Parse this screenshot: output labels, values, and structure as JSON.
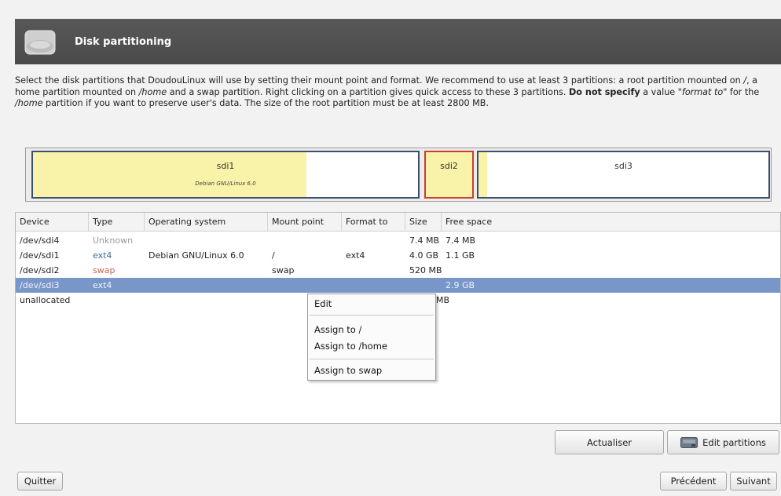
{
  "header": {
    "title": "Disk partitioning",
    "icon": "hard-disk-icon"
  },
  "intro": {
    "p1": "Select the disk partitions that DoudouLinux will use by setting their mount point and format. We recommend to use at least 3 partitions: a root partition mounted on ",
    "root": "/",
    "p2": ", a home partition mounted on ",
    "home": "/home",
    "p3": " and a swap partition. Right clicking on a partition gives quick access to these 3 partitions. ",
    "bold": "Do not specify",
    "p4": " a value ",
    "format_to": "\"format to\"",
    "p5": " for the ",
    "home2": "/home",
    "p6": " partition if you want to preserve user's data. The size of the root partition must be at least 2800 MB."
  },
  "partition_bar": {
    "segments": [
      {
        "name": "sdi1",
        "os": "Debian GNU/Linux 6.0",
        "used_fraction": 0.71
      },
      {
        "name": "sdi2",
        "os": "",
        "used_fraction": 1.0
      },
      {
        "name": "sdi3",
        "os": "",
        "used_fraction": 0.03
      }
    ]
  },
  "table": {
    "columns": [
      "Device",
      "Type",
      "Operating system",
      "Mount point",
      "Format to",
      "Size",
      "Free space"
    ],
    "rows": [
      {
        "device": "/dev/sdi4",
        "type": "Unknown",
        "os": "",
        "mount": "",
        "format": "",
        "size": "7.4 MB",
        "free": "7.4 MB"
      },
      {
        "device": "/dev/sdi1",
        "type": "ext4",
        "os": "Debian GNU/Linux 6.0",
        "mount": "/",
        "format": "ext4",
        "size": "4.0 GB",
        "free": "1.1 GB"
      },
      {
        "device": "/dev/sdi2",
        "type": "swap",
        "os": "",
        "mount": "swap",
        "format": "",
        "size": "520 MB",
        "free": ""
      },
      {
        "device": "/dev/sdi3",
        "type": "ext4",
        "os": "",
        "mount": "",
        "format": "",
        "size": "",
        "free": "2.9 GB"
      },
      {
        "device": "unallocated",
        "type": "",
        "os": "",
        "mount": "",
        "format": "",
        "size": "MB",
        "free": ""
      }
    ]
  },
  "context_menu": {
    "items": [
      "Edit",
      "Assign to /",
      "Assign to /home",
      "Assign to swap"
    ]
  },
  "buttons": {
    "refresh": "Actualiser",
    "edit_partitions": "Edit partitions",
    "quit": "Quitter",
    "previous": "Précédent",
    "next": "Suivant"
  },
  "colors": {
    "header": "#505050",
    "selection": "#7896c8",
    "used_space": "#f8f3a8",
    "partition_border": "#3a4f6e",
    "selected_partition_border": "#c8402c"
  }
}
